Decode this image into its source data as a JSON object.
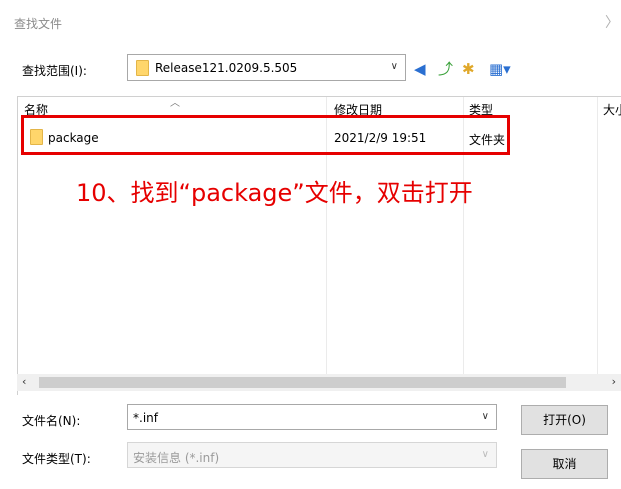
{
  "window": {
    "title": "查找文件",
    "close_glyph": "〉"
  },
  "lookin": {
    "label": "查找范围(I):",
    "value": "Release121.0209.5.505"
  },
  "toolbar": {
    "back_glyph": "◀",
    "up_glyph": "⤴",
    "newfolder_glyph": "✱",
    "view_glyph": "▦▾"
  },
  "columns": {
    "name": "名称",
    "date": "修改日期",
    "type": "类型",
    "size": "大小"
  },
  "files": [
    {
      "name": "package",
      "date": "2021/2/9 19:51",
      "type": "文件夹"
    }
  ],
  "annotation": "10、找到“package”文件，双击打开",
  "filename": {
    "label": "文件名(N):",
    "value": "*.inf"
  },
  "filetype": {
    "label": "文件类型(T):",
    "value": "安装信息 (*.inf)"
  },
  "buttons": {
    "open": "打开(O)",
    "cancel": "取消"
  },
  "colors": {
    "highlight": "#e60000",
    "annotation": "#e60000"
  }
}
